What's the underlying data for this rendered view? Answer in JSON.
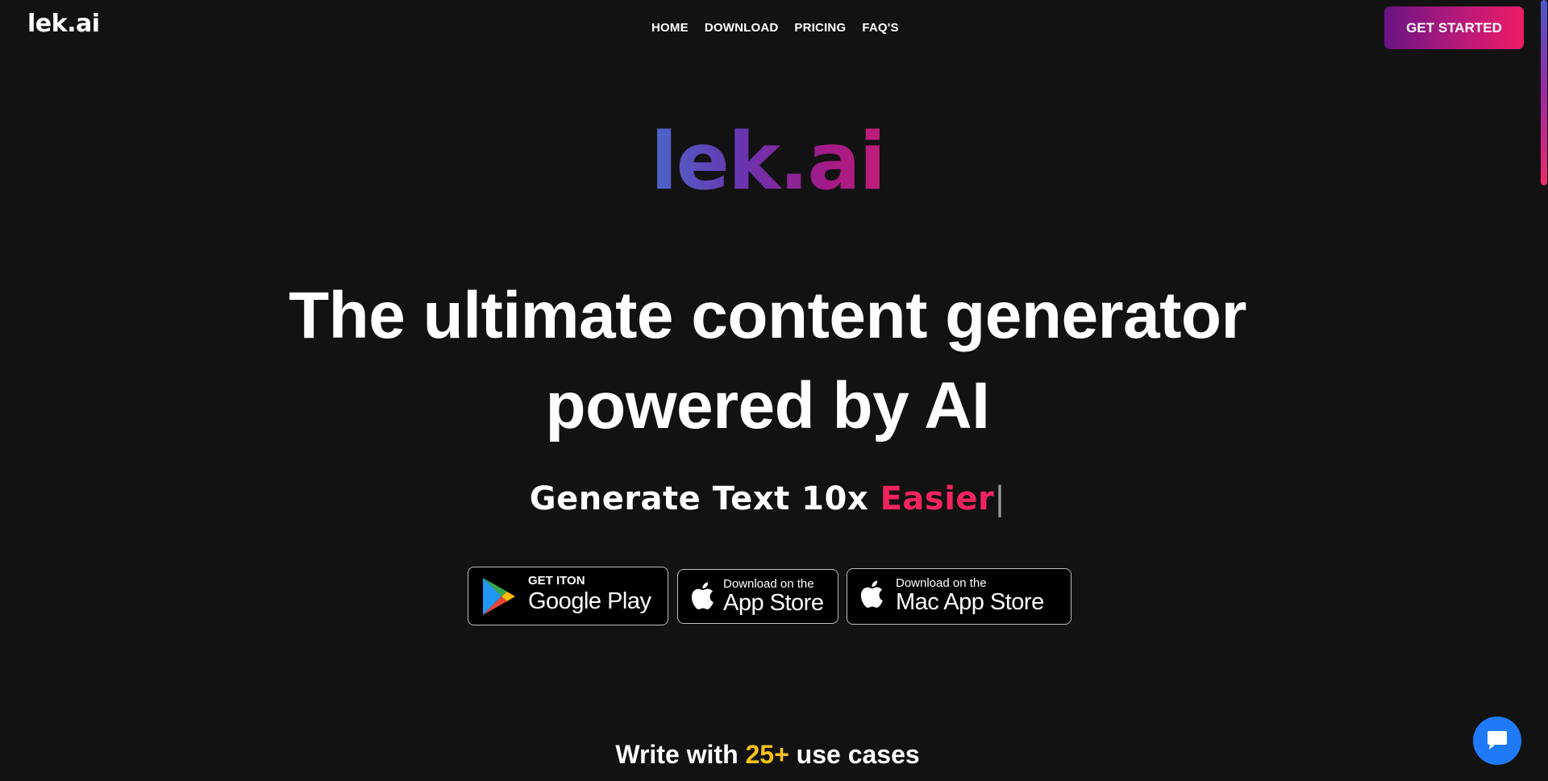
{
  "header": {
    "brand": "lek.ai",
    "nav": [
      "HOME",
      "DOWNLOAD",
      "PRICING",
      "FAQ'S"
    ],
    "cta_label": "GET STARTED"
  },
  "hero": {
    "logo": "lek.ai",
    "headline_line1": "The ultimate content generator",
    "headline_line2": "powered by AI",
    "sub_prefix": "Generate Text 10x ",
    "sub_accent": "Easier",
    "sub_cursor": "|"
  },
  "stores": {
    "google": {
      "small": "GET ITON",
      "big": "Google Play"
    },
    "app_store": {
      "small": "Download on the",
      "big": "App Store"
    },
    "mac_app_store": {
      "small": "Download on the",
      "big": "Mac App Store"
    }
  },
  "use_cases": {
    "prefix": "Write with ",
    "highlight": "25+",
    "suffix": " use cases"
  },
  "colors": {
    "background": "#121212",
    "accent_pink": "#f0245f",
    "highlight_yellow": "#f6c21b",
    "chat_blue": "#1f7bf5"
  },
  "icons": {
    "google_play": "google-play-icon",
    "apple": "apple-icon",
    "chat": "chat-icon"
  }
}
